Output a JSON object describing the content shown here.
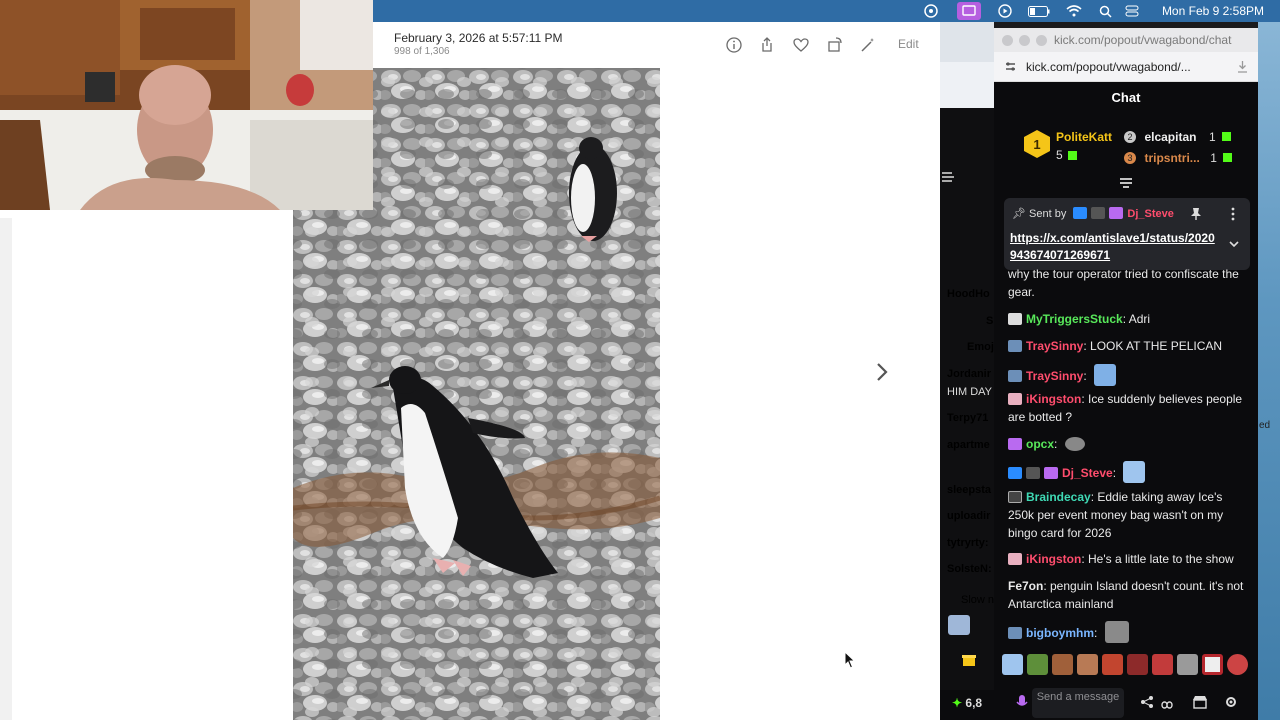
{
  "menubar": {
    "clock": "Mon Feb 9  2:58PM"
  },
  "photos": {
    "date": "February 3, 2026 at 5:57:11 PM",
    "count": "998 of 1,306",
    "edit_label": "Edit"
  },
  "browser": {
    "title": "kick.com/popout/vwagabond/chat",
    "url": "kick.com/popout/vwagabond/..."
  },
  "chat": {
    "header": "Chat",
    "leaderboard": [
      {
        "rank": "1",
        "name": "PoliteKatt",
        "count": "5",
        "color": "#f5c518"
      },
      {
        "rank": "2",
        "name": "elcapitan",
        "count": "1",
        "color": "#c9c9c9"
      },
      {
        "rank": "3",
        "name": "tripsntri...",
        "count": "1",
        "color": "#d9884a"
      }
    ],
    "pinned": {
      "sent_by": "Sent by",
      "user": "Dj_Steve",
      "link": "https://x.com/antislave1/status/2020943674071269671"
    },
    "messages": [
      {
        "user": "",
        "text": "why the tour operator tried to confiscate the gear.",
        "color": "#eaeaea"
      },
      {
        "user": "MyTriggersStuck",
        "text": ": Adri",
        "color": "#58e85a"
      },
      {
        "user": "TraySinny",
        "text": ": LOOK AT THE PELICAN",
        "color": "#ff4d6d"
      },
      {
        "user": "TraySinny",
        "text": ":",
        "color": "#ff4d6d"
      },
      {
        "user": "iKingston",
        "text": ": Ice suddenly believes people are botted ?",
        "color": "#ff4d6d"
      },
      {
        "user": "opcx",
        "text": ":",
        "color": "#58e85a"
      },
      {
        "user": "Dj_Steve",
        "text": ":",
        "color": "#ff4d6d"
      },
      {
        "user": "Braindecay",
        "text": ": Eddie taking away Ice's 250k per event money bag wasn't on my bingo card for 2026",
        "color": "#3fd9b4"
      },
      {
        "user": "iKingston",
        "text": ": He's a little late to the show",
        "color": "#ff4d6d"
      },
      {
        "user": "Fe7on",
        "text": ": penguin Island doesn't count. it's not Antarctica mainland",
        "color": "#eaeaea"
      },
      {
        "user": "bigboymhm",
        "text": ":",
        "color": "#7ab6ff"
      }
    ],
    "send_placeholder": "Send a message",
    "viewers": "6,8"
  },
  "middle_column": {
    "names": [
      {
        "name": "HoodHo",
        "color": "#58e85a"
      },
      {
        "name": "S",
        "color": "#ff4d6d"
      },
      {
        "name": "Emoj",
        "color": "#ff8a3d"
      },
      {
        "name": "Jordanir",
        "color": "#eaeaea"
      },
      {
        "name": "HIM DAY",
        "color": "#eaeaea"
      },
      {
        "name": "Terpy71",
        "color": "#58e85a"
      },
      {
        "name": "apartme",
        "color": "#3b8cff"
      },
      {
        "name": "sleepsta",
        "color": "#ff4d6d"
      },
      {
        "name": "uploadir",
        "color": "#58e85a"
      },
      {
        "name": "tytryrty:",
        "color": "#b58cff"
      },
      {
        "name": "SolsteN:",
        "color": "#eaeaea"
      },
      {
        "name": "Slow n",
        "color": "#aaaaaa"
      }
    ]
  },
  "desktop": {
    "edge_text": "ed"
  }
}
